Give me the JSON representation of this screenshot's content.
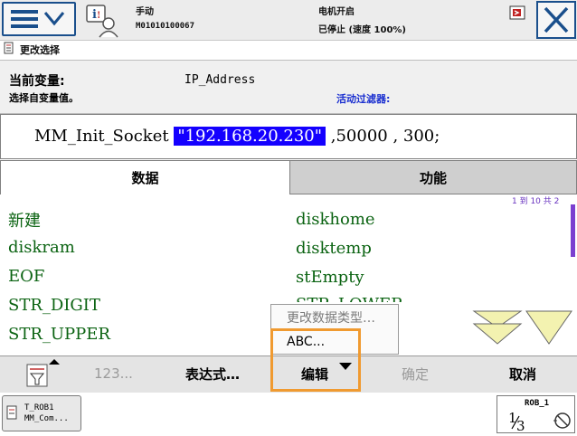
{
  "header": {
    "mode_label": "手动",
    "controller_id": "M01010100067",
    "motor_status": "电机开启",
    "run_status": "已停止 (速度 100%)"
  },
  "window": {
    "title": "更改选择"
  },
  "info": {
    "current_var_label": "当前变量:",
    "current_var_value": "IP_Address",
    "select_label": "选择自变量值。",
    "filter_label": "活动过滤器:"
  },
  "expression": {
    "prefix": "MM_Init_Socket ",
    "selected_arg": "\"192.168.20.230\"",
    "suffix": " ,50000 , 300;"
  },
  "tabs": [
    {
      "label": "数据"
    },
    {
      "label": "功能"
    }
  ],
  "list": {
    "page_info": "1 到 10 共 2",
    "items_left": [
      "新建",
      "diskram",
      "EOF",
      "STR_DIGIT",
      "STR_UPPER"
    ],
    "items_right": [
      "diskhome",
      "disktemp",
      "stEmpty",
      "STR_LOWER"
    ]
  },
  "popup": {
    "change_type": "更改数据类型…",
    "abc": "ABC..."
  },
  "toolbar": {
    "num_label": "123...",
    "expression_label": "表达式…",
    "edit_label": "编辑",
    "ok_label": "确定",
    "cancel_label": "取消"
  },
  "taskbar": {
    "task_line1": "T_ROB1",
    "task_line2": "MM_Com...",
    "rob_label": "ROB_1",
    "rob_fraction_num": "1",
    "rob_fraction_den": "3"
  },
  "colors": {
    "accent_blue": "#1a4f8c",
    "selection_blue": "#1400ff",
    "list_green": "#0b6312",
    "highlight_orange": "#f09a30",
    "arrow_yellow": "#f3f2b0"
  }
}
